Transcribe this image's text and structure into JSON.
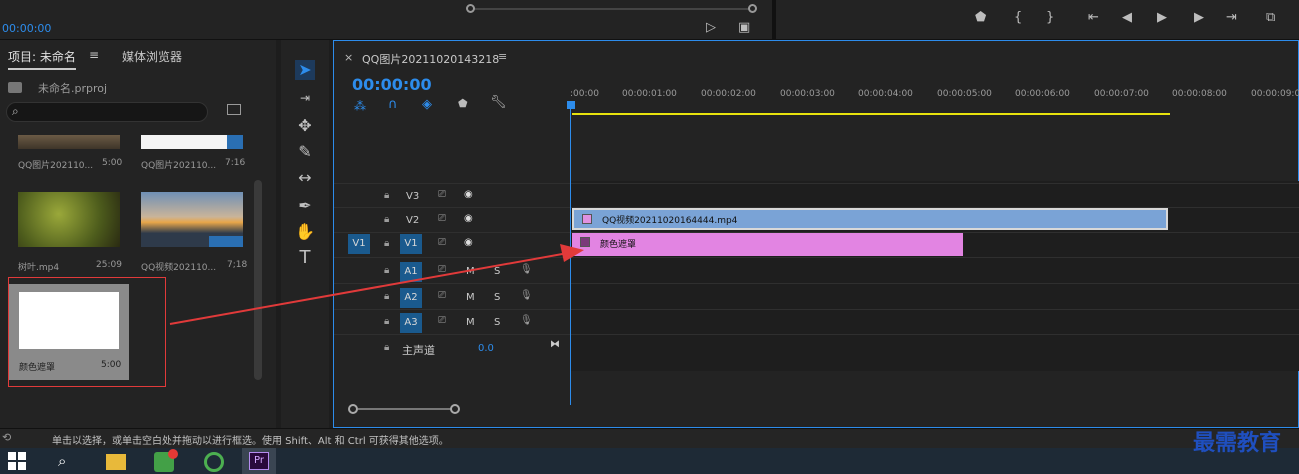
{
  "source_monitor": {
    "timecode": "00:00:00"
  },
  "project_panel": {
    "tab_project": "项目: 未命名",
    "tab_media": "媒体浏览器",
    "file_name": "未命名.prproj",
    "items": [
      {
        "name": "QQ图片202110...",
        "duration": "5:00"
      },
      {
        "name": "QQ图片202110...",
        "duration": "7:16"
      },
      {
        "name": "树叶.mp4",
        "duration": "25:09"
      },
      {
        "name": "QQ视频202110...",
        "duration": "7;18"
      },
      {
        "name": "颜色遮罩",
        "duration": "5:00"
      }
    ]
  },
  "timeline": {
    "tab_title": "QQ图片20211020143218",
    "timecode": "00:00:00",
    "ruler": [
      ":00:00",
      "00:00:01:00",
      "00:00:02:00",
      "00:00:03:00",
      "00:00:04:00",
      "00:00:05:00",
      "00:00:06:00",
      "00:00:07:00",
      "00:00:08:00",
      "00:00:09:0"
    ],
    "tracks": {
      "v3": "V3",
      "v2": "V2",
      "v1": "V1",
      "v1_src": "V1",
      "a1": "A1",
      "a2": "A2",
      "a3": "A3",
      "m": "M",
      "s": "S",
      "master_label": "主声道",
      "master_value": "0.0"
    },
    "clip_v2": "QQ视频20211020164444.mp4",
    "clip_v1": "颜色遮罩"
  },
  "status_bar": {
    "text": "单击以选择，或单击空白处并拖动以进行框选。使用 Shift、Alt 和 Ctrl 可获得其他选项。"
  },
  "watermark": "最需教育",
  "colors": {
    "accent": "#2d8ceb",
    "clip_video": "#7aa3d6",
    "clip_matte": "#e284e2",
    "workarea": "#e7e20d",
    "highlight": "#e13a3a"
  }
}
